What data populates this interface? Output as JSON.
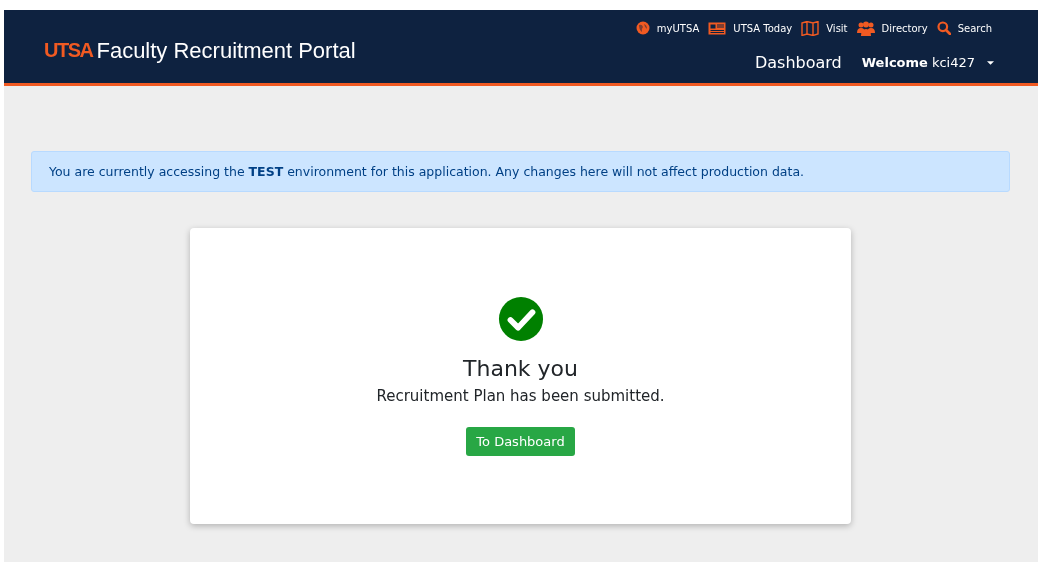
{
  "header": {
    "logo": "UTSA",
    "title": "Faculty Recruitment Portal",
    "utility_links": [
      {
        "kind": "globe",
        "label": "myUTSA"
      },
      {
        "kind": "news",
        "label": "UTSA Today"
      },
      {
        "kind": "map",
        "label": "Visit"
      },
      {
        "kind": "people",
        "label": "Directory"
      },
      {
        "kind": "search",
        "label": "Search"
      }
    ],
    "nav": {
      "dashboard": "Dashboard",
      "welcome": "Welcome",
      "user": "kci427"
    }
  },
  "alert": "You are currently accessing the **TEST** environment for this application. Any changes here will not affect production data.",
  "card": {
    "title": "Thank you",
    "message": "Recruitment Plan has been submitted.",
    "button": "To Dashboard"
  }
}
